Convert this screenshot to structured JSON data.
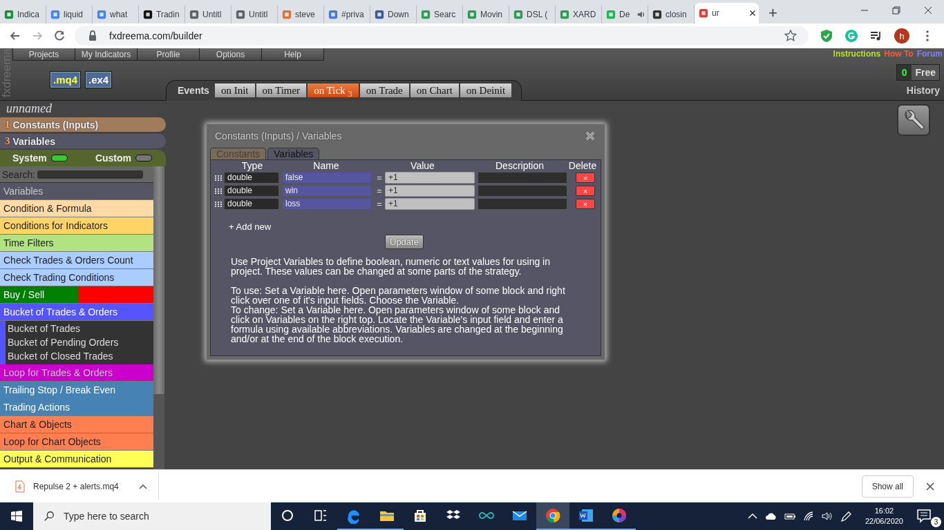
{
  "browser": {
    "tabs": [
      {
        "title": "Indica",
        "color": "#1e8e3e",
        "selected": false
      },
      {
        "title": "liquid",
        "color": "#4285f4",
        "selected": false
      },
      {
        "title": "what",
        "color": "#4285f4",
        "selected": false
      },
      {
        "title": "Tradin",
        "color": "#111111",
        "selected": false
      },
      {
        "title": "Untitl",
        "color": "#5f6368",
        "selected": false
      },
      {
        "title": "Untitl",
        "color": "#5f6368",
        "selected": false
      },
      {
        "title": "steve",
        "color": "#d9773a",
        "selected": false
      },
      {
        "title": "#priva",
        "color": "#4a7bd0",
        "selected": false
      },
      {
        "title": "Down",
        "color": "#3c5a9a",
        "selected": false
      },
      {
        "title": "Searc",
        "color": "#2f9a5a",
        "selected": false
      },
      {
        "title": "Movin",
        "color": "#2f9a5a",
        "selected": false
      },
      {
        "title": "DSL (",
        "color": "#2f9a5a",
        "selected": false
      },
      {
        "title": "XARD",
        "color": "#2f9a5a",
        "selected": false
      },
      {
        "title": "De",
        "color": "#1db954",
        "selected": false,
        "audio": true
      },
      {
        "title": "closin",
        "color": "#333333",
        "selected": false
      },
      {
        "title": "ur",
        "color": "#e0403a",
        "selected": true
      }
    ],
    "new_tab": "+",
    "url": "fxdreema.com/builder",
    "profile": "h"
  },
  "app": {
    "logo": "fxdreema",
    "menu": [
      "Projects",
      "My Indicators",
      "Profile",
      "Options",
      "Help"
    ],
    "file_buttons": [
      ".mq4",
      ".ex4"
    ],
    "events_label": "Events",
    "events": [
      {
        "label": "on Init",
        "selected": false
      },
      {
        "label": "on Timer",
        "selected": false
      },
      {
        "label": "on Tick",
        "count": "3",
        "selected": true
      },
      {
        "label": "on Trade",
        "selected": false
      },
      {
        "label": "on Chart",
        "selected": false
      },
      {
        "label": "on Deinit",
        "selected": false
      }
    ],
    "links": [
      {
        "label": "Instructions",
        "color": "#b5e61d"
      },
      {
        "label": "How To",
        "color": "#ff5a36"
      },
      {
        "label": "Forum",
        "color": "#8080ff"
      }
    ],
    "credits": {
      "count": "0",
      "label": "Free"
    },
    "history": "History"
  },
  "sidebar": {
    "project": "unnamed",
    "sections": [
      {
        "count": "1",
        "label": "Constants (Inputs)",
        "color": "#a07c5c"
      },
      {
        "count": "3",
        "label": "Variables",
        "color": "#555566"
      }
    ],
    "toggles": [
      {
        "label": "System",
        "on": true
      },
      {
        "label": "Custom",
        "on": false
      }
    ],
    "search_label": "Search:",
    "categories": [
      {
        "label": "Variables",
        "color": "#555566",
        "kind": "plain"
      },
      {
        "label": "Condition & Formula",
        "color": "#ffdaa5",
        "kind": "plain"
      },
      {
        "label": "Conditions for Indicators",
        "color": "#ffd466",
        "kind": "plain"
      },
      {
        "label": "Time Filters",
        "color": "#b3e283",
        "kind": "plain"
      },
      {
        "label": "Check Trades & Orders Count",
        "color": "#aaccff",
        "kind": "plain"
      },
      {
        "label": "Check Trading Conditions",
        "color": "#aaccff",
        "kind": "plain"
      },
      {
        "kind": "split",
        "segments": [
          {
            "label": "Buy / Sell",
            "color": "#008000"
          },
          {
            "color": "#ff0000"
          }
        ]
      },
      {
        "label": "Bucket of Trades & Orders",
        "color": "#5555ff",
        "kind": "plain",
        "children": [
          {
            "label": "Bucket of Trades"
          },
          {
            "label": "Bucket of Pending Orders"
          },
          {
            "label": "Bucket of Closed Trades"
          }
        ]
      },
      {
        "label": "Loop for Trades & Orders",
        "color": "#cc00cc",
        "kind": "plain"
      },
      {
        "label": "Trailing Stop / Break Even",
        "color": "#4682b4",
        "kind": "plain"
      },
      {
        "label": "Trading Actions",
        "color": "#4682b4",
        "kind": "plain"
      },
      {
        "label": "Chart & Objects",
        "color": "#ff7f50",
        "kind": "plain"
      },
      {
        "label": "Loop for Chart Objects",
        "color": "#ff7f50",
        "kind": "plain"
      },
      {
        "label": "Output & Communication",
        "color": "#ffff55",
        "kind": "plain"
      }
    ]
  },
  "dialog": {
    "title": "Constants (Inputs) / Variables",
    "tabs": [
      {
        "label": "Constants",
        "selected": false
      },
      {
        "label": "Variables",
        "selected": true
      }
    ],
    "columns": [
      "Type",
      "Name",
      "Value",
      "Description",
      "Delete"
    ],
    "rows": [
      {
        "type": "double",
        "name": "false",
        "operator": "=",
        "value": "+1",
        "delete": "×"
      },
      {
        "type": "double",
        "name": "win",
        "operator": "=",
        "value": "+1",
        "delete": "×"
      },
      {
        "type": "double",
        "name": "loss",
        "operator": "=",
        "value": "+1",
        "delete": "×"
      }
    ],
    "add_new": "+ Add new",
    "update": "Update",
    "help": [
      "Use Project Variables to define boolean, numeric or text values for using in project. These values can be changed at some parts of the strategy.",
      "To use: Set a Variable here. Open parameters window of some block and right click over one of it's input fields. Choose the Variable.",
      "To change: Set a Variable here. Open parameters window of some block and click on Variables on the right top. Locate the Variable's input field and enter a formula using available abbreviations. Variables are changed at the beginning and/or at the end of the block execution."
    ]
  },
  "downloads": {
    "file": "Repulse 2 + alerts.mq4",
    "show_all": "Show all"
  },
  "taskbar": {
    "search": "Type here to search",
    "apps": [
      {
        "kind": "cortana",
        "running": false,
        "selected": false
      },
      {
        "kind": "taskview",
        "running": false,
        "selected": false
      },
      {
        "kind": "edge",
        "running": true,
        "selected": false
      },
      {
        "kind": "explorer",
        "running": true,
        "selected": false
      },
      {
        "kind": "store",
        "running": false,
        "selected": false
      },
      {
        "kind": "dropbox",
        "running": false,
        "selected": false
      },
      {
        "kind": "arduino",
        "running": false,
        "selected": false
      },
      {
        "kind": "mail",
        "running": false,
        "selected": false
      },
      {
        "kind": "chrome",
        "running": true,
        "selected": true
      },
      {
        "kind": "word",
        "running": true,
        "selected": false
      },
      {
        "kind": "paint",
        "running": true,
        "selected": false
      }
    ],
    "time": "16:02",
    "date": "22/06/2020",
    "notifications": "3"
  }
}
